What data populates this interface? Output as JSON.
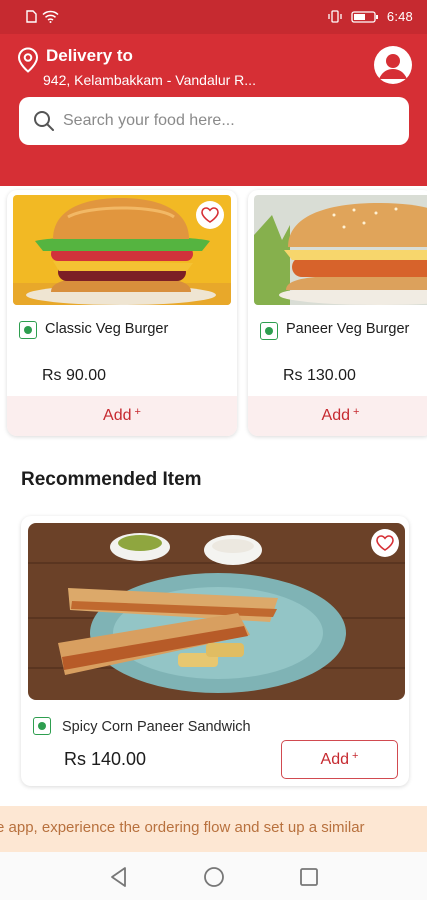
{
  "status_bar": {
    "time": "6:48",
    "icons": [
      "sim-icon",
      "wifi-icon",
      "vibrate-icon",
      "battery-icon"
    ]
  },
  "header": {
    "delivery_label": "Delivery to",
    "address": "942, Kelambakkam - Vandalur R...",
    "profile_icon": "user-avatar-icon",
    "location_icon": "location-pin-icon"
  },
  "search": {
    "placeholder": "Search your food here...",
    "value": ""
  },
  "products": [
    {
      "name": "Classic Veg Burger",
      "price": "Rs 90.00",
      "add_label": "Add",
      "add_symbol": "+",
      "veg": true
    },
    {
      "name": "Paneer Veg Burger",
      "price": "Rs 130.00",
      "add_label": "Add",
      "add_symbol": "+",
      "veg": true
    }
  ],
  "recommended": {
    "title": "Recommended Item",
    "item": {
      "name": "Spicy Corn Paneer Sandwich",
      "price": "Rs 140.00",
      "add_label": "Add",
      "add_symbol": "+",
      "veg": true
    }
  },
  "ticker": {
    "text": "e app, experience the ordering flow and set up a similar"
  },
  "colors": {
    "brand_red": "#d62f35",
    "status_red": "#c62a30",
    "veg_green": "#2e9e4f",
    "ticker_bg": "#fde7d3",
    "ticker_text": "#b8713e"
  },
  "nav": {
    "icons": [
      "back-icon",
      "home-icon",
      "recents-icon"
    ]
  }
}
